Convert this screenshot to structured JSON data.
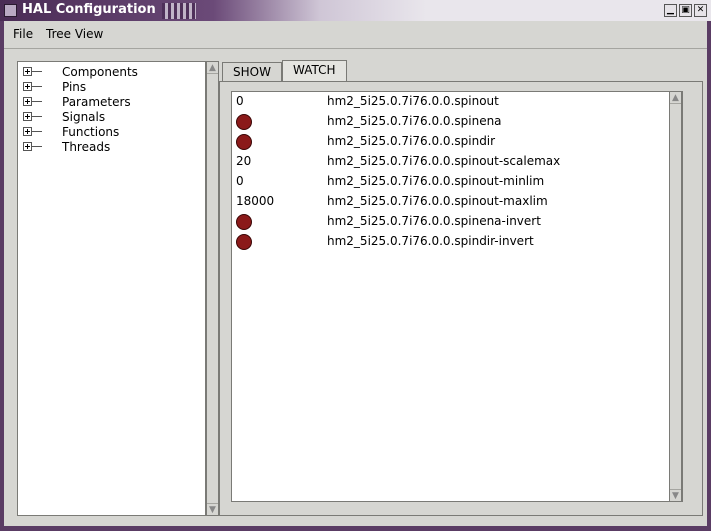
{
  "window": {
    "title": "HAL Configuration",
    "controls": {
      "minimize": "▁",
      "maximize": "▣",
      "close": "✕"
    },
    "accent_color": "#5a3c64"
  },
  "menubar": {
    "items": [
      {
        "label": "File"
      },
      {
        "label": "Tree View"
      }
    ]
  },
  "tree": {
    "items": [
      {
        "label": "Components"
      },
      {
        "label": "Pins"
      },
      {
        "label": "Parameters"
      },
      {
        "label": "Signals"
      },
      {
        "label": "Functions"
      },
      {
        "label": "Threads"
      }
    ]
  },
  "tabs": [
    {
      "label": "SHOW",
      "active": false
    },
    {
      "label": "WATCH",
      "active": true
    }
  ],
  "watch": {
    "led_color": "#8b1a1a",
    "rows": [
      {
        "type": "value",
        "value": "0",
        "name": "hm2_5i25.0.7i76.0.0.spinout"
      },
      {
        "type": "led",
        "value": "",
        "name": "hm2_5i25.0.7i76.0.0.spinena"
      },
      {
        "type": "led",
        "value": "",
        "name": "hm2_5i25.0.7i76.0.0.spindir"
      },
      {
        "type": "value",
        "value": "20",
        "name": "hm2_5i25.0.7i76.0.0.spinout-scalemax"
      },
      {
        "type": "value",
        "value": "0",
        "name": "hm2_5i25.0.7i76.0.0.spinout-minlim"
      },
      {
        "type": "value",
        "value": "18000",
        "name": "hm2_5i25.0.7i76.0.0.spinout-maxlim"
      },
      {
        "type": "led",
        "value": "",
        "name": "hm2_5i25.0.7i76.0.0.spinena-invert"
      },
      {
        "type": "led",
        "value": "",
        "name": "hm2_5i25.0.7i76.0.0.spindir-invert"
      }
    ]
  }
}
